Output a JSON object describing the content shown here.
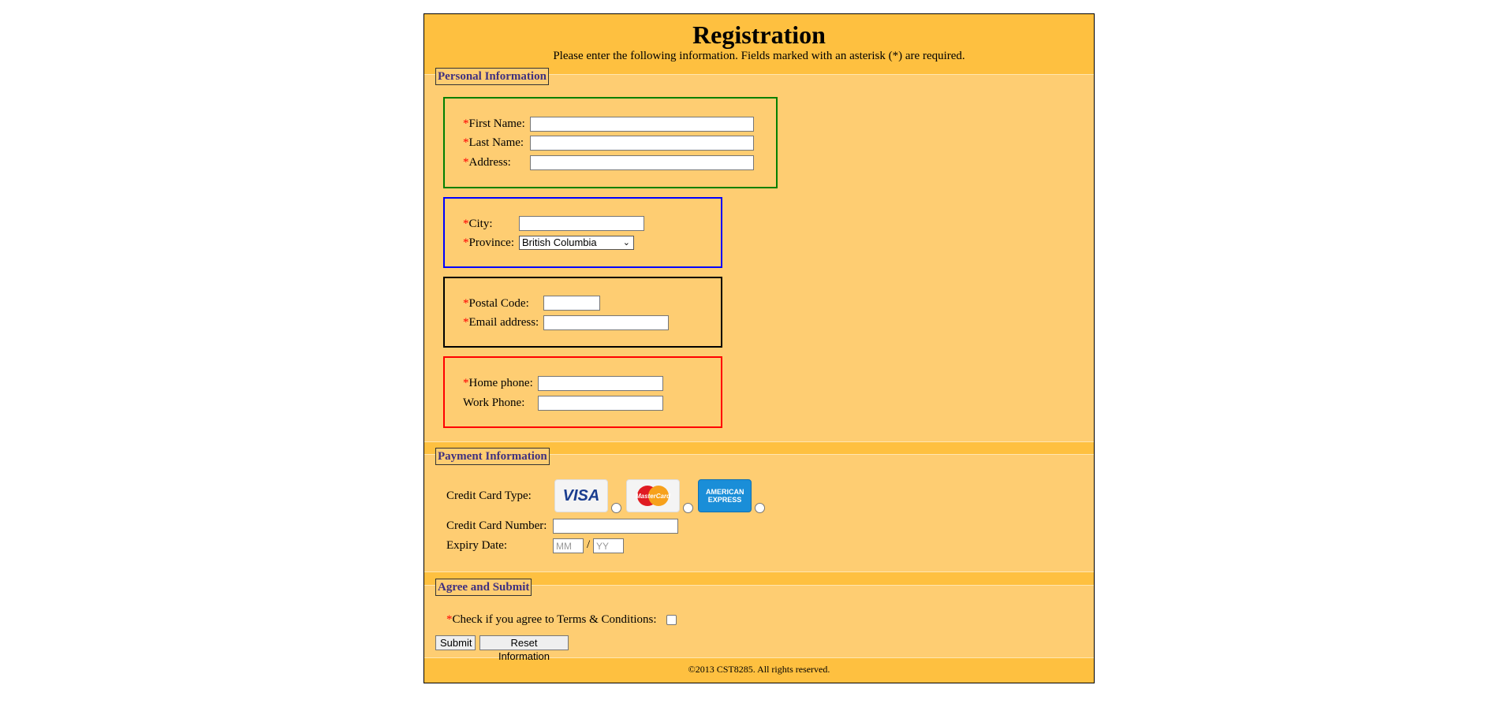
{
  "header": {
    "title": "Registration",
    "instructions": "Please enter the following information. Fields marked with an asterisk (*) are required."
  },
  "personal": {
    "legend": "Personal Information",
    "required_mark": "*",
    "first_name_label": "First Name:",
    "last_name_label": "Last Name:",
    "address_label": "Address:",
    "city_label": "City:",
    "province_label": "Province:",
    "province_value": "British Columbia",
    "postal_label": "Postal Code:",
    "email_label": "Email address:",
    "home_phone_label": "Home phone:",
    "work_phone_label": "Work Phone:",
    "box_colors": [
      "#008000",
      "#0000ff",
      "#000000",
      "#ff0000"
    ]
  },
  "payment": {
    "legend": "Payment Information",
    "card_type_label": "Credit Card Type:",
    "cards": [
      {
        "name": "visa-card-icon",
        "text": "VISA"
      },
      {
        "name": "mastercard-card-icon",
        "text": "MasterCard"
      },
      {
        "name": "amex-card-icon",
        "text": "AMERICAN EXPRESS"
      }
    ],
    "card_number_label": "Credit Card Number:",
    "expiry_label": "Expiry Date:",
    "expiry_month_placeholder": "MM",
    "expiry_separator": "/",
    "expiry_year_placeholder": "YY"
  },
  "agree": {
    "legend": "Agree and Submit",
    "terms_label": "Check if you agree to Terms & Conditions:",
    "submit_label": "Submit",
    "reset_label": "Reset Information"
  },
  "footer": {
    "text": "©2013 CST8285. All rights reserved."
  },
  "colors": {
    "page_bg": "#fec040",
    "section_bg": "#fecd72",
    "legend_text": "#3f3080",
    "required": "#ff0000"
  }
}
